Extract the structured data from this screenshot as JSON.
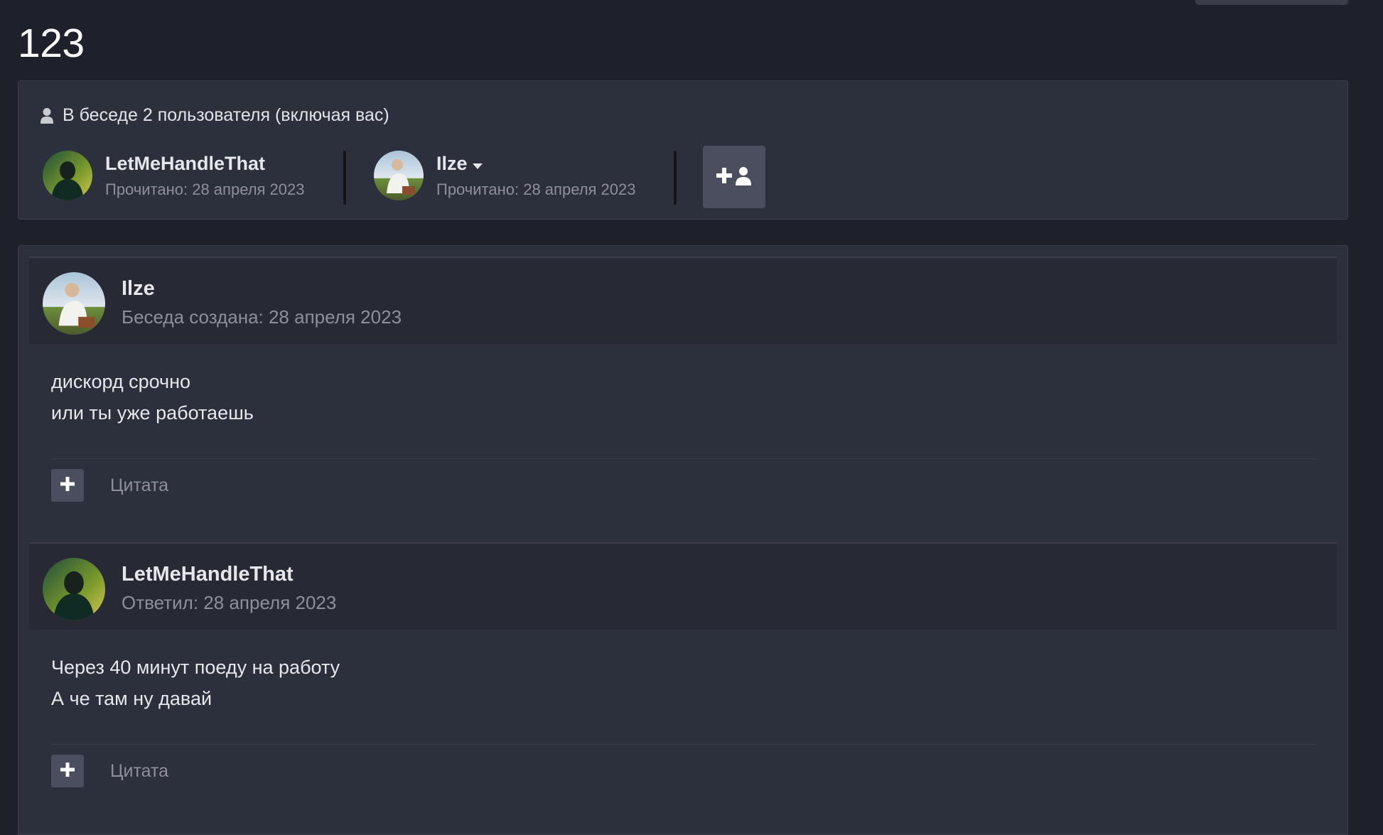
{
  "page": {
    "title": "123"
  },
  "participants": {
    "heading": "В беседе 2 пользователя (включая вас)",
    "users": [
      {
        "name": "LetMeHandleThat",
        "read": "Прочитано: 28 апреля 2023",
        "avatar": "avatar-dark-figure"
      },
      {
        "name": "Ilze",
        "read": "Прочитано: 28 апреля 2023",
        "avatar": "avatar-painting",
        "has_dropdown": true
      }
    ],
    "add_user_icon": "add-user-icon"
  },
  "messages": [
    {
      "author": "Ilze",
      "meta": "Беседа создана: 28 апреля 2023",
      "lines": [
        "дискорд срочно",
        "или ты уже работаешь"
      ],
      "quote_label": "Цитата"
    },
    {
      "author": "LetMeHandleThat",
      "meta": "Ответил: 28 апреля 2023",
      "lines": [
        "Через 40 минут поеду на работу",
        "А че там ну давай"
      ],
      "quote_label": "Цитата"
    }
  ],
  "colors": {
    "background": "#1e202b",
    "panel": "#2c303c",
    "header": "#272a35",
    "muted_text": "#8d909a",
    "button": "#4a4e5e"
  }
}
